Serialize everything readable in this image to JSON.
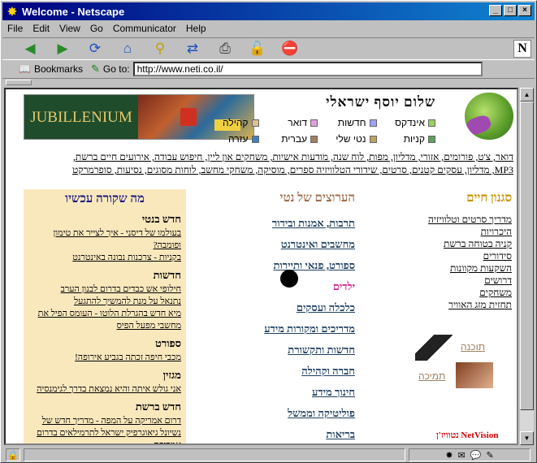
{
  "window": {
    "title": "Welcome - Netscape"
  },
  "menu": [
    "File",
    "Edit",
    "View",
    "Go",
    "Communicator",
    "Help"
  ],
  "toolbar": [
    "back-icon",
    "forward-icon",
    "reload-icon",
    "home-icon",
    "search-icon",
    "guide-icon",
    "print-icon",
    "security-icon",
    "stop-icon"
  ],
  "location": {
    "bookmarks_label": "Bookmarks",
    "goto_label": "Go to:",
    "url": "http://www.neti.co.il/"
  },
  "page": {
    "banner_text": "JUBILLENIUM",
    "greeting": "שלום יוסף ישראלי",
    "nav": [
      {
        "label": "אינדקס",
        "color": "#9bd05f"
      },
      {
        "label": "חדשות",
        "color": "#a0a0ff"
      },
      {
        "label": "דואר",
        "color": "#e0a0e0"
      },
      {
        "label": "קהילה",
        "color": "#e0c090"
      },
      {
        "label": "קניות",
        "color": "#60a060"
      },
      {
        "label": "נטי שלי",
        "color": "#c0a060"
      },
      {
        "label": "עברית",
        "color": "#a08060"
      },
      {
        "label": "עזרה",
        "color": "#4080c0"
      }
    ],
    "link_line1": "דואר, צ'ט, פורומים, אזורי, מדליון, מפות, לוח שנה, מודעות אישיות, משחקים און ליין, חיפוש עבודה, אירועים חיים ברשת,",
    "link_line2": "MP3, מדליון, עסקים קטנים, סרטים, שידורי הטלוויזיה ספרים, מוסיקה, משחקי מחשב, לוחות מסוגים, נסיעות, סופרמרקט",
    "col_lifestyle": {
      "title": "סגנון חיים",
      "links": [
        "מדריך סרטים וטלוויזיה",
        "היכרויות",
        "קניה בטוחה ברשת",
        "סידורים",
        "השקעות מקוונות",
        "דרושים",
        "משחקים",
        "תחזית מזג האוויר"
      ]
    },
    "col_channels": {
      "title": "הערוצים של נטי",
      "links": [
        "תרבות, אמנות ובידור",
        "מחשבים ואינטרנט",
        "ספורט, פנאי ותיירות",
        "ילדים",
        "כלכלה ועסקים",
        "מדריכים ומקורות מידע",
        "חדשות ותקשורת",
        "חברה וקהילה",
        "חינוך מידע",
        "פוליטיקה וממשל",
        "בריאות"
      ]
    },
    "col_now": {
      "title": "מה שקורה עכשיו",
      "sections": [
        {
          "heading": "חדש בנטי",
          "items": [
            "בעולמו של דיסני - איך לצייר את טימון ופומבה?",
            "בקניות - צרכנות נבונה באינטרנט"
          ]
        },
        {
          "heading": "חדשות",
          "items": [
            "חילופי אש כבדים בדרום לבנון הערב",
            "נתנאל על מנת להמשיך להתגעל",
            "מיא חדש בהגרלת הלוטו - העומס הפיל את מחשבי מפעל הפיס"
          ]
        },
        {
          "heading": "ספורט",
          "items": [
            "מכבי חיפה זכתה בגביע אירופה!"
          ]
        },
        {
          "heading": "מגזין",
          "items": [
            "אני גולש איתה והיא נמצאת בדרך לגימנסיה"
          ]
        },
        {
          "heading": "חדש ברשת",
          "items": [
            "דרום אמריקה על המפה - מדריך חדש של נשיונל גיאוגרפיק ישראל לתרמילאים בדרום אמריקה"
          ]
        }
      ]
    },
    "promo1": "תוכנה",
    "promo2": "תמיכה",
    "logos": "נטוויז'ן NetVision"
  }
}
